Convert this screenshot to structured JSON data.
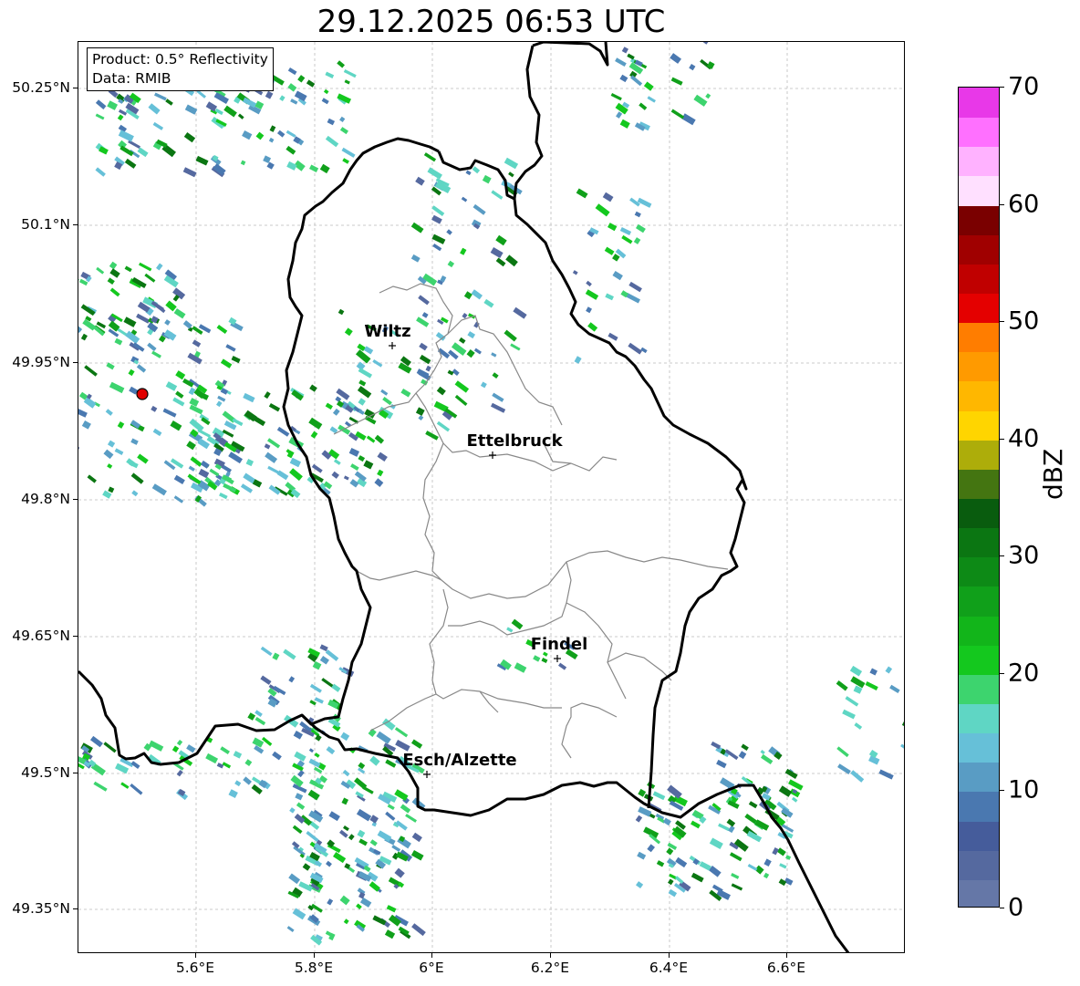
{
  "title": "29.12.2025 06:53 UTC",
  "info": {
    "product": "Product: 0.5° Reflectivity",
    "source": "Data: RMIB"
  },
  "lat_labels": [
    "50.25°N",
    "50.1°N",
    "49.95°N",
    "49.8°N",
    "49.65°N",
    "49.5°N",
    "49.35°N"
  ],
  "lon_labels": [
    "5.6°E",
    "5.8°E",
    "6°E",
    "6.2°E",
    "6.4°E",
    "6.6°E"
  ],
  "cities": [
    {
      "name": "Wiltz"
    },
    {
      "name": "Ettelbruck"
    },
    {
      "name": "Findel"
    },
    {
      "name": "Esch/Alzette"
    }
  ],
  "colorbar": {
    "label": "dBZ",
    "ticks": [
      "0",
      "10",
      "20",
      "30",
      "40",
      "50",
      "60",
      "70"
    ],
    "colors": [
      "#6577a7",
      "#55699f",
      "#455c9b",
      "#4a78b0",
      "#599cc4",
      "#66c0d8",
      "#5fd6c4",
      "#3dd46e",
      "#14c81e",
      "#12b51a",
      "#10a01a",
      "#0d8a16",
      "#0b7612",
      "#095c0e",
      "#447511",
      "#adad0a",
      "#ffd500",
      "#ffb700",
      "#ff9a00",
      "#ff7d00",
      "#e40000",
      "#c00000",
      "#a00000",
      "#7a0000",
      "#ffe0ff",
      "#ffb2ff",
      "#ff70ff",
      "#e838e8"
    ]
  },
  "radar_site": {
    "color": "#e00000"
  }
}
